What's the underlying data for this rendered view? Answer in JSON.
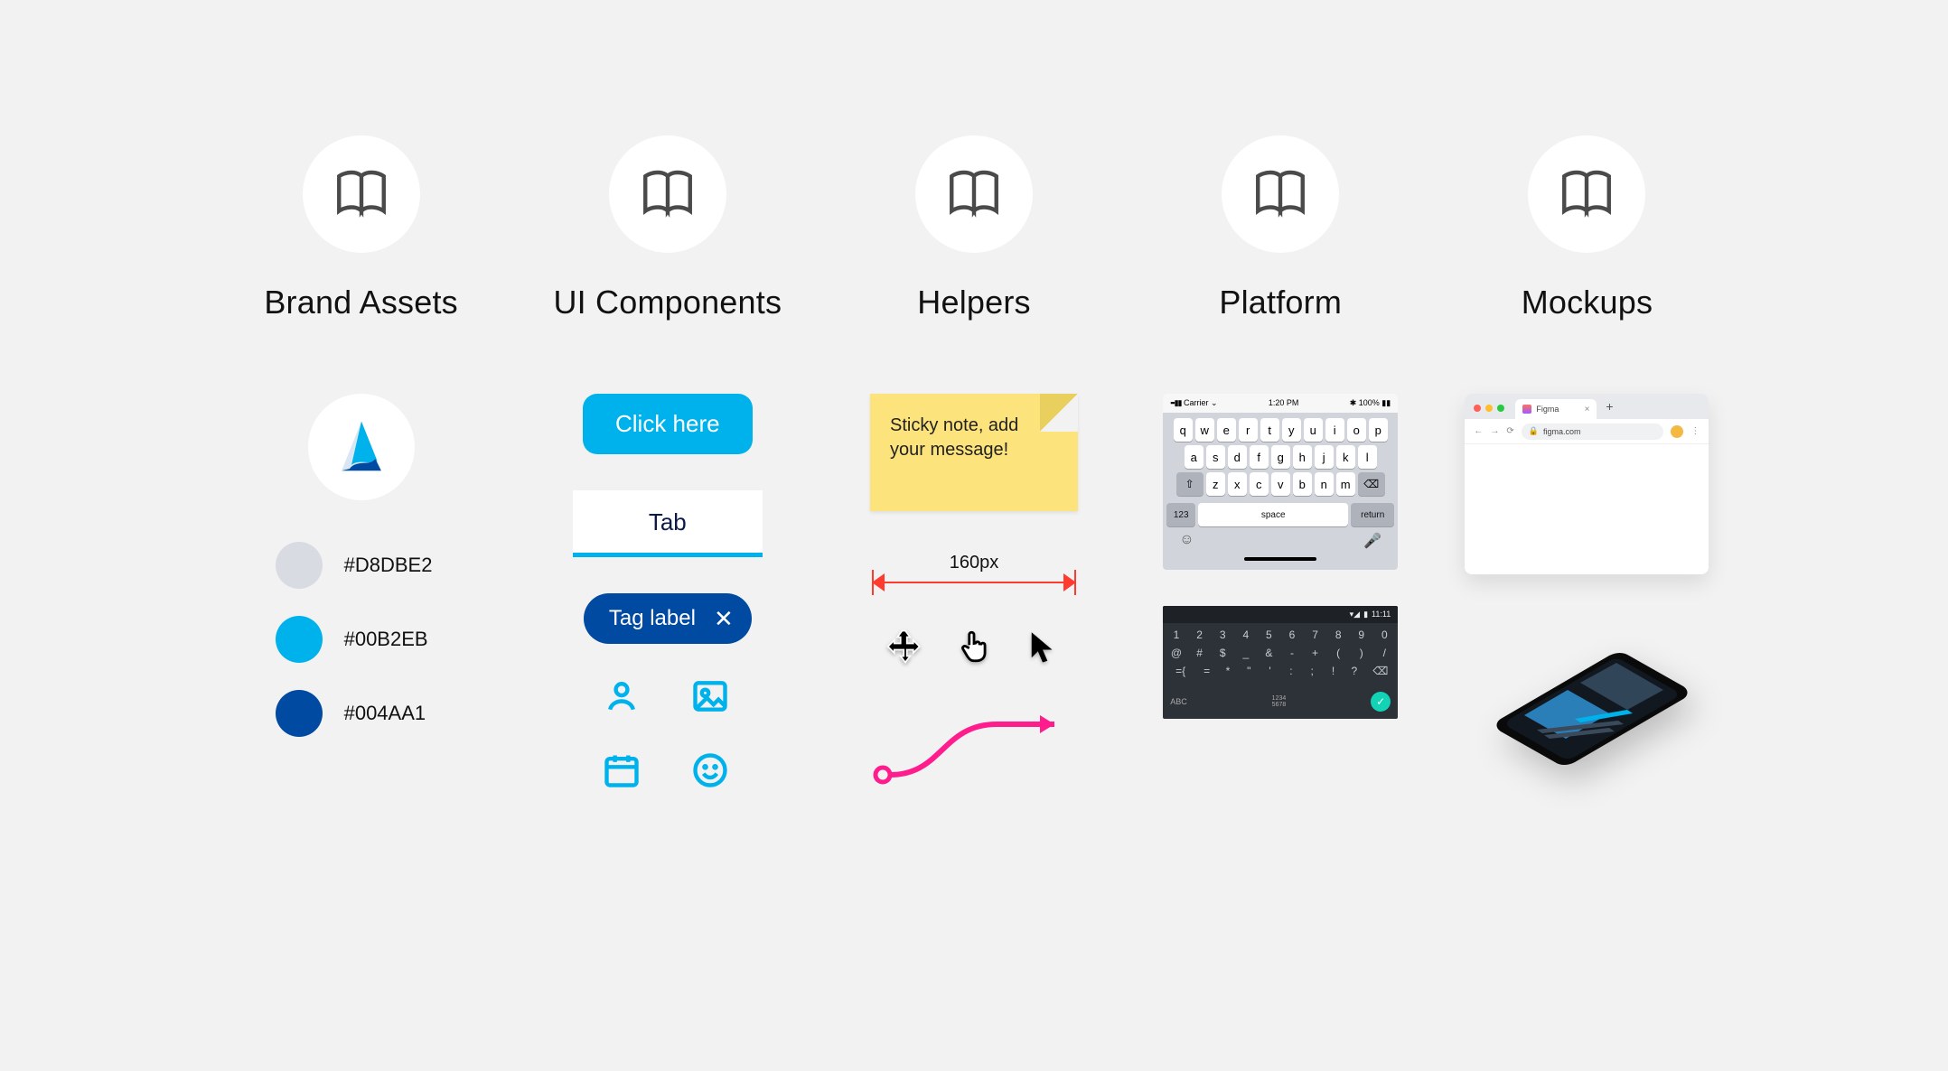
{
  "columns": [
    {
      "title": "Brand Assets"
    },
    {
      "title": "UI Components"
    },
    {
      "title": "Helpers"
    },
    {
      "title": "Platform"
    },
    {
      "title": "Mockups"
    }
  ],
  "brand": {
    "swatches": [
      {
        "hex": "#D8DBE2"
      },
      {
        "hex": "#00B2EB"
      },
      {
        "hex": "#004AA1"
      }
    ]
  },
  "ui": {
    "button_label": "Click here",
    "tab_label": "Tab",
    "tag_label": "Tag label",
    "icons": [
      "user-icon",
      "image-icon",
      "calendar-icon",
      "smile-icon"
    ]
  },
  "helpers": {
    "sticky_text": "Sticky note, add your message!",
    "ruler_label": "160px"
  },
  "platform": {
    "ios": {
      "status_left": "Carrier",
      "status_time": "1:20 PM",
      "status_right": "100%",
      "row1": [
        "q",
        "w",
        "e",
        "r",
        "t",
        "y",
        "u",
        "i",
        "o",
        "p"
      ],
      "row2": [
        "a",
        "s",
        "d",
        "f",
        "g",
        "h",
        "j",
        "k",
        "l"
      ],
      "row3": [
        "z",
        "x",
        "c",
        "v",
        "b",
        "n",
        "m"
      ],
      "num_label": "123",
      "space_label": "space",
      "return_label": "return"
    },
    "android": {
      "status_time": "11:11",
      "row1": [
        "1",
        "2",
        "3",
        "4",
        "5",
        "6",
        "7",
        "8",
        "9",
        "0"
      ],
      "row2": [
        "@",
        "#",
        "$",
        "_",
        "&",
        "-",
        "+",
        "(",
        ")",
        "/"
      ],
      "row3": [
        "=",
        "*",
        "\"",
        "'",
        ":",
        ";",
        "!",
        "?"
      ],
      "abc_label": "ABC",
      "nums_label": "1234\n5678"
    }
  },
  "mockups": {
    "browser": {
      "tab_title": "Figma",
      "url": "figma.com"
    }
  },
  "colors": {
    "accent": "#00B2EB",
    "deep": "#004AA1",
    "pink": "#ff1d8e",
    "ruler": "#ff3b30"
  }
}
